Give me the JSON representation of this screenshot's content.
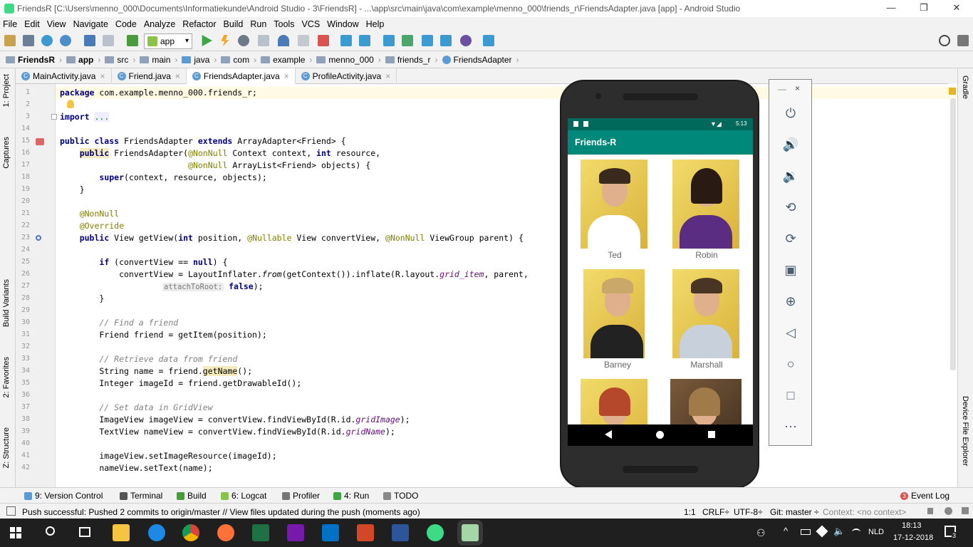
{
  "window": {
    "title": "FriendsR [C:\\Users\\menno_000\\Documents\\Informatiekunde\\Android Studio - 3\\FriendsR] - ...\\app\\src\\main\\java\\com\\example\\menno_000\\friends_r\\FriendsAdapter.java [app] - Android Studio",
    "minimize": "—",
    "maximize": "❐",
    "close": "✕"
  },
  "menu": [
    "File",
    "Edit",
    "View",
    "Navigate",
    "Code",
    "Analyze",
    "Refactor",
    "Build",
    "Run",
    "Tools",
    "VCS",
    "Window",
    "Help"
  ],
  "toolbar": {
    "run_config": "app"
  },
  "breadcrumb": [
    "FriendsR",
    "app",
    "src",
    "main",
    "java",
    "com",
    "example",
    "menno_000",
    "friends_r",
    "FriendsAdapter"
  ],
  "tabs": [
    {
      "label": "MainActivity.java",
      "active": false
    },
    {
      "label": "Friend.java",
      "active": false
    },
    {
      "label": "FriendsAdapter.java",
      "active": true
    },
    {
      "label": "ProfileActivity.java",
      "active": false
    }
  ],
  "left_tools": [
    "1: Project",
    "Captures",
    "Build Variants",
    "2: Favorites",
    "Z: Structure"
  ],
  "right_tools": [
    "Gradle",
    "Device File Explorer"
  ],
  "code": {
    "line_numbers": [
      "1",
      "2",
      "3",
      "14",
      "15",
      "16",
      "17",
      "18",
      "19",
      "20",
      "21",
      "22",
      "23",
      "24",
      "25",
      "26",
      "27",
      "28",
      "29",
      "30",
      "31",
      "32",
      "33",
      "34",
      "35",
      "36",
      "37",
      "38",
      "39",
      "40",
      "41",
      "42"
    ],
    "l1a": "package ",
    "l1b": "com.example.menno_000.friends_r;",
    "l3a": "import ",
    "l3b": "...",
    "l15a": "public class ",
    "l15b": "FriendsAdapter ",
    "l15c": "extends ",
    "l15d": "ArrayAdapter<Friend> {",
    "l16a": "    ",
    "l16b": "public",
    "l16c": " FriendsAdapter(",
    "l16d": "@NonNull",
    "l16e": " Context context, ",
    "l16f": "int",
    "l16g": " resource,",
    "l17a": "                          ",
    "l17b": "@NonNull",
    "l17c": " ArrayList<Friend> objects) {",
    "l18a": "        ",
    "l18b": "super",
    "l18c": "(context, resource, objects);",
    "l19": "    }",
    "l21": "    @NonNull",
    "l22": "    @Override",
    "l23a": "    ",
    "l23b": "public",
    "l23c": " View getView(",
    "l23d": "int",
    "l23e": " position, ",
    "l23f": "@Nullable",
    "l23g": " View convertView, ",
    "l23h": "@NonNull",
    "l23i": " ViewGroup parent) {",
    "l25a": "        ",
    "l25b": "if",
    "l25c": " (convertView == ",
    "l25d": "null",
    "l25e": ") {",
    "l26a": "            convertView = LayoutInflater.",
    "l26b": "from",
    "l26c": "(getContext()).inflate(R.layout.",
    "l26d": "grid_item",
    "l26e": ", parent,",
    "l27hint": "attachToRoot:",
    "l27a": " false",
    "l27b": ");",
    "l28": "        }",
    "l30": "        // Find a friend",
    "l31": "        Friend friend = getItem(position);",
    "l33": "        // Retrieve data from friend",
    "l34a": "        String name = friend.",
    "l34b": "getName",
    "l34c": "();",
    "l35": "        Integer imageId = friend.getDrawableId();",
    "l37": "        // Set data in GridView",
    "l38a": "        ImageView imageView = convertView.findViewById(R.id.",
    "l38b": "gridImage",
    "l38c": ");",
    "l39a": "        TextView nameView = convertView.findViewById(R.id.",
    "l39b": "gridName",
    "l39c": ");",
    "l41": "        imageView.setImageResource(imageId);",
    "l42": "        nameView.setText(name);"
  },
  "emulator": {
    "time": "5:13",
    "app_title": "Friends-R",
    "friends": [
      "Ted",
      "Robin",
      "Barney",
      "Marshall",
      "",
      ""
    ]
  },
  "bottom_tools": [
    "9: Version Control",
    "Terminal",
    "Build",
    "6: Logcat",
    "Profiler",
    "4: Run",
    "TODO",
    "Event Log"
  ],
  "event_count": "3",
  "status": {
    "message": "Push successful: Pushed 2 commits to origin/master // View files updated during the push (moments ago)",
    "position": "1:1",
    "line_sep": "CRLF÷",
    "encoding": "UTF-8÷",
    "git": "Git: master ÷",
    "context": "Context: <no context>"
  },
  "taskbar": {
    "lang": "NLD",
    "time": "18:13",
    "date": "17-12-2018",
    "notif": "3"
  }
}
